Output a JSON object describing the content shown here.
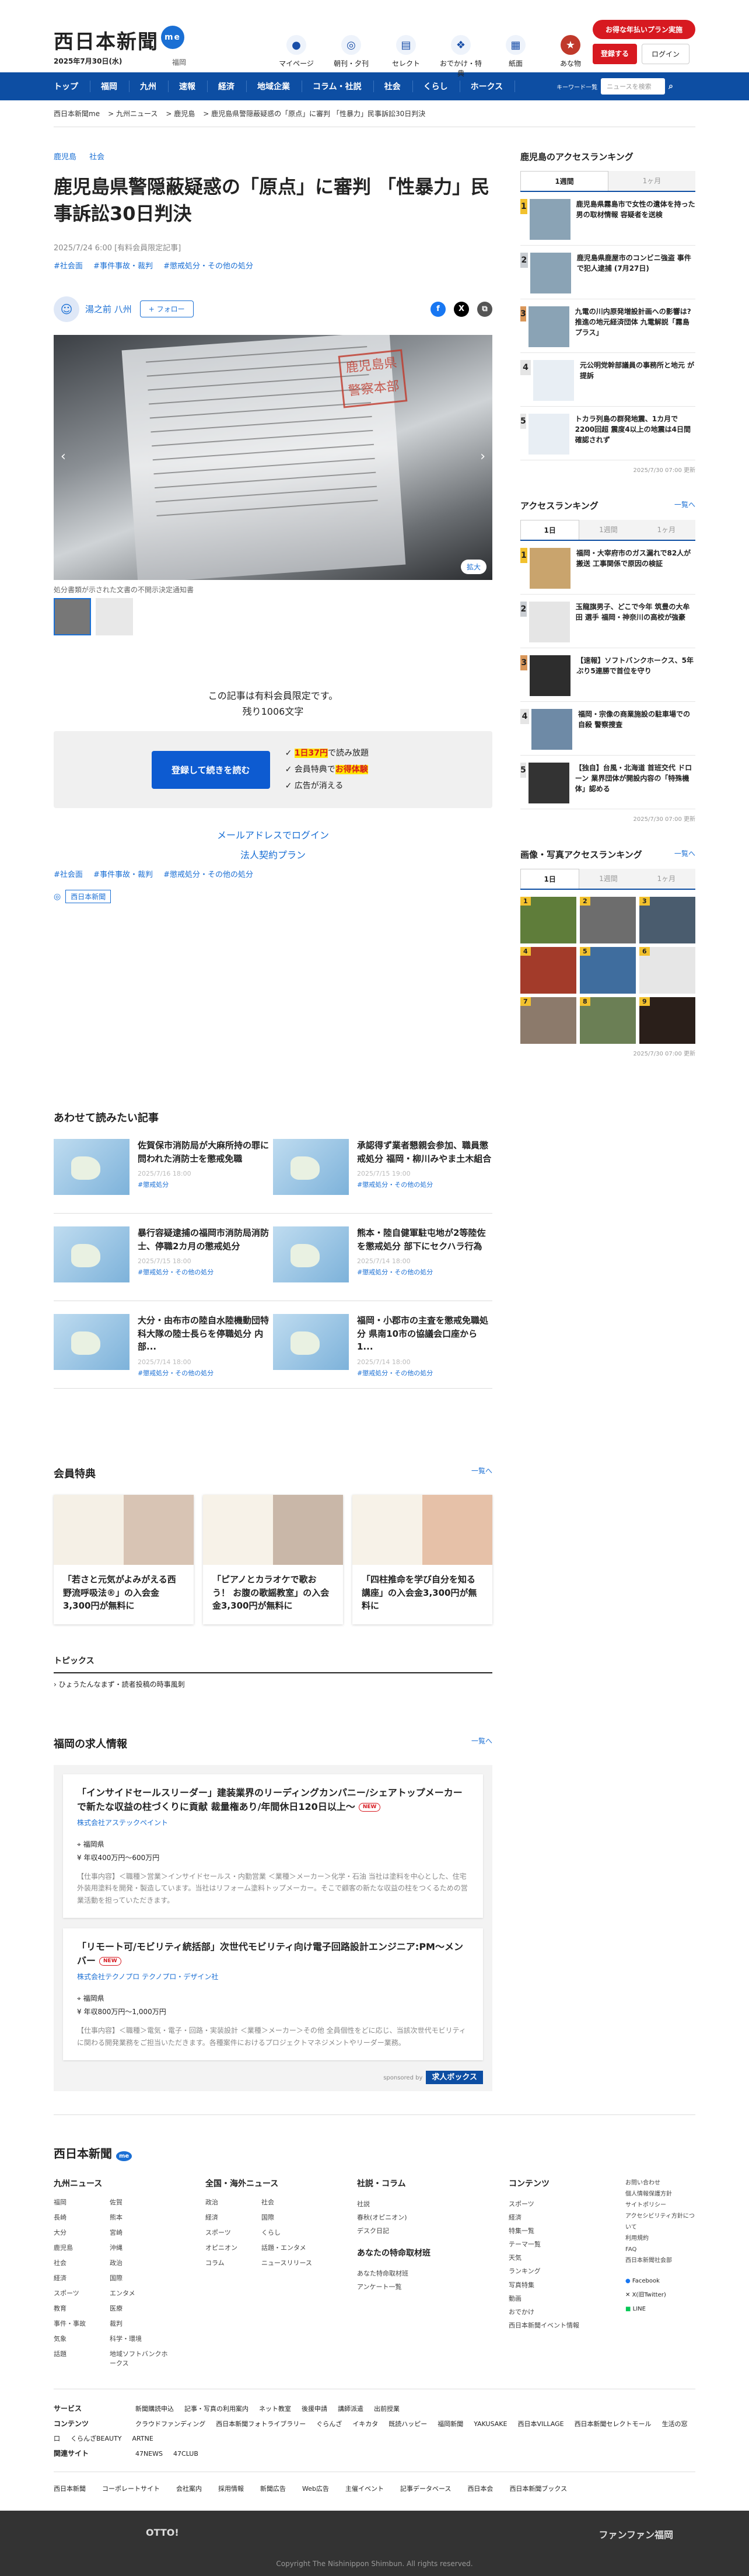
{
  "header": {
    "logo": "西日本新聞",
    "logo_badge": "me",
    "date": "2025年7月30日(水)",
    "region": "福岡",
    "icons": [
      {
        "icon": "me-icon",
        "label": "マイページ"
      },
      {
        "icon": "newspaper-icon",
        "label": "朝刊・夕刊"
      },
      {
        "icon": "select-icon",
        "label": "セレクト"
      },
      {
        "icon": "footprint-icon",
        "label": "おでかけ・特典"
      },
      {
        "icon": "paper-icon",
        "label": "紙面"
      },
      {
        "icon": "kids-icon",
        "label": "あな物"
      }
    ],
    "promo_button": "お得な年払いプラン実施",
    "register_button": "登録する",
    "login_button": "ログイン"
  },
  "nav": {
    "items": [
      "トップ",
      "福岡",
      "九州",
      "速報",
      "経済",
      "地域企業",
      "コラム・社説",
      "社会",
      "くらし",
      "ホークス"
    ],
    "keyword_label": "キーワード一覧",
    "search_placeholder": "ニュースを検索"
  },
  "breadcrumb": [
    "西日本新聞me",
    "九州ニュース",
    "鹿児島",
    "鹿児島県警隠蔽疑惑の「原点」に審判 「性暴力」民事訴訟30日判決"
  ],
  "article": {
    "categories": [
      "鹿児島",
      "社会"
    ],
    "title": "鹿児島県警隠蔽疑惑の「原点」に審判 「性暴力」民事訴訟30日判決",
    "meta": "2025/7/24 6:00 [有料会員限定記事]",
    "tags": [
      "#社会面",
      "#事件事故・裁判",
      "#懲戒処分・その他の処分"
    ],
    "author": "湯之前 八州",
    "follow": "+ フォロー",
    "stamp": "鹿児島県警察本部",
    "zoom": "拡大",
    "caption": "処分書類が示された文書の不開示決定通知書",
    "locked_notice": "この記事は有料会員限定です。",
    "remaining": "残り1006文字",
    "pay_button": "登録して続きを読む",
    "pay_points": [
      {
        "hl": "1日37円",
        "rest": "で読み放題"
      },
      {
        "pre": "会員特典で",
        "hl": "お得体験"
      },
      {
        "rest": "広告が消える"
      }
    ],
    "email_login": "メールアドレスでログイン",
    "corp_plan": "法人契約プラン",
    "source": "西日本新聞"
  },
  "sidebar": {
    "kagoshima": {
      "title": "鹿児島のアクセスランキング",
      "tabs": [
        "1週間",
        "1ヶ月"
      ],
      "items": [
        "鹿児島県霧島市で女性の遺体を持った男の取材情報 容疑者を送検",
        "鹿児島県鹿屋市のコンビニ強盗 事件で犯人逮捕 (7月27日)",
        "九電の川内原発増設計画への影響は? 推進の地元経済団体 九電解説「霧島プラス」",
        "元公明党幹部議員の事務所と地元 が提訴",
        "トカラ列島の群発地震、1カ月で2200回超 震度4以上の地震は4日間確認されず"
      ],
      "updated": "2025/7/30 07:00 更新"
    },
    "access": {
      "title": "アクセスランキング",
      "more": "一覧へ",
      "tabs": [
        "1日",
        "1週間",
        "1ヶ月"
      ],
      "items": [
        "福岡・大宰府市のガス漏れで82人が搬送 工事関係で原因の検証",
        "玉龍旗男子、どこで今年 筑豊の大牟田 選手 福岡・神奈川の高校が強豪",
        "【速報】ソフトバンクホークス、5年ぶり5連勝で首位を守り",
        "福岡・宗像の商業施設の駐車場での自殺 警察捜査",
        "【独自】台風・北海道 首班交代 ドローン 業界団体が開設内容の「特殊機体」認める"
      ],
      "updated": "2025/7/30 07:00 更新"
    },
    "photos": {
      "title": "画像・写真アクセスランキング",
      "more": "一覧へ",
      "tabs": [
        "1日",
        "1週間",
        "1ヶ月"
      ],
      "ranks": [
        "1",
        "2",
        "3",
        "4",
        "5",
        "6",
        "7",
        "8",
        "9"
      ],
      "updated": "2025/7/30 07:00 更新"
    }
  },
  "related": {
    "title": "あわせて読みたい記事",
    "items": [
      {
        "title": "佐賀保市消防局が大麻所持の罪に問われた消防士を懲戒免職",
        "date": "2025/7/16 18:00",
        "tag": "#懲戒処分"
      },
      {
        "title": "承認得ず業者懇親会参加、職員懲戒処分 福岡・柳川みやま土木組合",
        "date": "2025/7/15 19:00",
        "tag": "#懲戒処分・その他の処分"
      },
      {
        "title": "暴行容疑逮捕の福岡市消防局消防士、停職2カ月の懲戒処分",
        "date": "2025/7/15 18:00",
        "tag": "#懲戒処分・その他の処分"
      },
      {
        "title": "熊本・陸自健軍駐屯地が2等陸佐を懲戒処分 部下にセクハラ行為",
        "date": "2025/7/14 18:00",
        "tag": "#懲戒処分・その他の処分"
      },
      {
        "title": "大分・由布市の陸自水陸機動団特科大隊の陸士長らを停職処分 内部...",
        "date": "2025/7/14 18:00",
        "tag": "#懲戒処分・その他の処分"
      },
      {
        "title": "福岡・小郡市の主査を懲戒免職処分 県南10市の協議会口座から1...",
        "date": "2025/7/14 18:00",
        "tag": "#懲戒処分・その他の処分"
      }
    ]
  },
  "perks": {
    "title": "会員特典",
    "more": "一覧へ",
    "items": [
      "「若さと元気がよみがえる西野流呼吸法®」の入会金3,300円が無料に",
      "「ピアノとカラオケで歌おう！ お腹の歌謡教室」の入会金3,300円が無料に",
      "「四柱推命を学び自分を知る講座」の入会金3,300円が無料に"
    ]
  },
  "topics": {
    "title": "トピックス",
    "item": "ひょうたんなまず・読者投稿の時事風刺"
  },
  "jobs": {
    "title": "福岡の求人情報",
    "more": "一覧へ",
    "items": [
      {
        "title": "「インサイドセールスリーダー」建装業界のリーディングカンパニー/シェアトップメーカーで新たな収益の柱づくりに貢献 裁量権あり/年間休日120日以上〜",
        "new": "NEW",
        "company": "株式会社アステックペイント",
        "place": "福岡県",
        "salary": "年収400万円〜600万円",
        "desc": "【仕事内容】＜職種＞営業＞インサイドセールス・内勤営業 ＜業種＞メーカー＞化学・石油 当社は塗料を中心とした、住宅外装用塗料を開発・製造しています。当社はリフォーム塗料トップメーカー。そこで顧客の新たな収益の柱をつくるための営業活動を担っていただきます。"
      },
      {
        "title": "「リモート可/モビリティ統括部」次世代モビリティ向け電子回路設計エンジニア:PM〜メンバー",
        "new": "NEW",
        "company": "株式会社テクノプロ テクノプロ・デザイン社",
        "place": "福岡県",
        "salary": "年収800万円〜1,000万円",
        "desc": "【仕事内容】＜職種＞電気・電子・回路・実装設計 ＜業種＞メーカー＞その他 全員個性をどに応じ、当該次世代モビリティに関わる開発業務をご担当いただきます。各種案件におけるプロジェクトマネジメントやリーダー業務。"
      }
    ],
    "sponsored": "sponsored by",
    "sponsor_logo": "求人ボックス"
  },
  "footer": {
    "logo": "西日本新聞",
    "cols": [
      {
        "title": "九州ニュース",
        "items": [
          "福岡",
          "佐賀",
          "長崎",
          "熊本",
          "大分",
          "宮崎",
          "鹿児島",
          "沖縄",
          "社会",
          "政治",
          "経済",
          "国際",
          "スポーツ",
          "エンタメ",
          "教育",
          "医療",
          "事件・事故",
          "裁判",
          "気象",
          "科学・環境",
          "話題",
          "地域ソフトバンクホークス"
        ]
      },
      {
        "title": "全国・海外ニュース",
        "items": [
          "政治",
          "社会",
          "経済",
          "国際",
          "スポーツ",
          "くらし",
          "オピニオン",
          "話題・エンタメ",
          "コラム",
          "ニュースリリース"
        ]
      },
      {
        "title": "社説・コラム",
        "items": [
          "社説",
          "春秋(オピニオン)",
          "デスク日記"
        ],
        "title2": "あなたの特命取材班",
        "items2": [
          "あなた特命取材班",
          "アンケート一覧"
        ]
      },
      {
        "title": "コンテンツ",
        "items": [
          "スポーツ",
          "経済",
          "特集一覧",
          "テーマ一覧",
          "天気",
          "ランキング",
          "写真特集",
          "動画",
          "おでかけ",
          "西日本新聞イベント情報"
        ]
      },
      {
        "title": "",
        "items": [
          "お問い合わせ",
          "個人情報保護方針",
          "サイトポリシー",
          "アクセシビリティ方針について",
          "利用規約",
          "FAQ",
          "西日本新聞社会部"
        ],
        "social": [
          "Facebook",
          "X(旧Twitter)",
          "LINE"
        ]
      }
    ],
    "rows": [
      {
        "label": "サービス",
        "items": [
          "新聞購読申込",
          "記事・写真の利用案内",
          "ネット教室",
          "後援申請",
          "講師派遣",
          "出前授業"
        ]
      },
      {
        "label": "コンテンツ",
        "items": [
          "クラウドファンディング",
          "西日本新聞フォトライブラリー",
          "ぐらんざ",
          "イキカタ",
          "既読ハッピー",
          "福岡新聞",
          "YAKUSAKE",
          "西日本VILLAGE",
          "西日本新聞セレクトモール",
          "生活の窓口",
          "くらんざBEAUTY",
          "ARTNE"
        ]
      },
      {
        "label": "関連サイト",
        "items": [
          "47NEWS",
          "47CLUB"
        ]
      }
    ],
    "bottom": [
      "西日本新聞",
      "コーポレートサイト",
      "会社案内",
      "採用情報",
      "新聞広告",
      "Web広告",
      "主催イベント",
      "記事データベース",
      "西日本会",
      "西日本新聞ブックス"
    ],
    "partner_logo": "OTTO!",
    "partner_logo2": "ファンファン福岡",
    "copyright": "Copyright The Nishinippon Shimbun. All rights reserved."
  }
}
